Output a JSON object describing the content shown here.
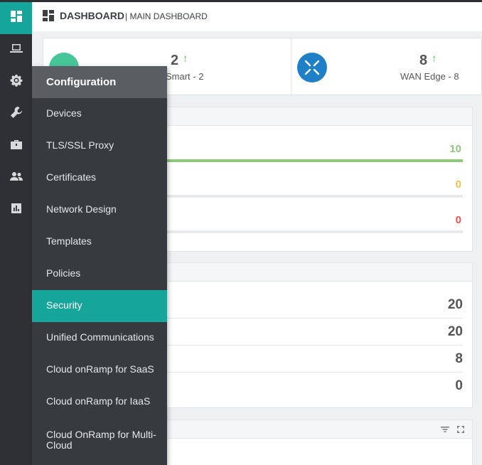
{
  "header": {
    "title": "DASHBOARD",
    "subtitle": "| MAIN DASHBOARD"
  },
  "rail": {
    "icons": [
      "dashboard-icon",
      "monitor-icon",
      "configuration-gear-icon",
      "tools-wrench-icon",
      "maintenance-toolbox-icon",
      "administration-users-icon",
      "analytics-chart-icon"
    ]
  },
  "summary": {
    "smart": {
      "count": "2",
      "arrow": "↑",
      "label": "Smart - 2"
    },
    "wan": {
      "count": "8",
      "arrow": "↑",
      "label": "WAN Edge - 8"
    }
  },
  "health_panel": {
    "bars": [
      {
        "value": "10",
        "fill": 1.0,
        "color": "#8cc97c"
      },
      {
        "value": "0",
        "fill": 0,
        "color": "#f0c24b"
      },
      {
        "value": "0",
        "fill": 0,
        "color": "#e8574e"
      }
    ]
  },
  "count_panel": {
    "rows": [
      "20",
      "20",
      "8",
      "0"
    ]
  },
  "flyout": {
    "title": "Configuration",
    "items": [
      {
        "label": "Devices"
      },
      {
        "label": "TLS/SSL Proxy"
      },
      {
        "label": "Certificates"
      },
      {
        "label": "Network Design"
      },
      {
        "label": "Templates"
      },
      {
        "label": "Policies"
      },
      {
        "label": "Security",
        "active": true
      },
      {
        "label": "Unified Communications"
      },
      {
        "label": "Cloud onRamp for SaaS"
      },
      {
        "label": "Cloud onRamp for IaaS"
      },
      {
        "label": "Cloud OnRamp for Multi-Cloud"
      }
    ]
  },
  "colors": {
    "accent": "#16a59a",
    "rail_bg": "#2e3033",
    "flyout_bg": "#373b3f",
    "flyout_header_bg": "#5a5e63",
    "up_arrow": "#5cb85c"
  }
}
